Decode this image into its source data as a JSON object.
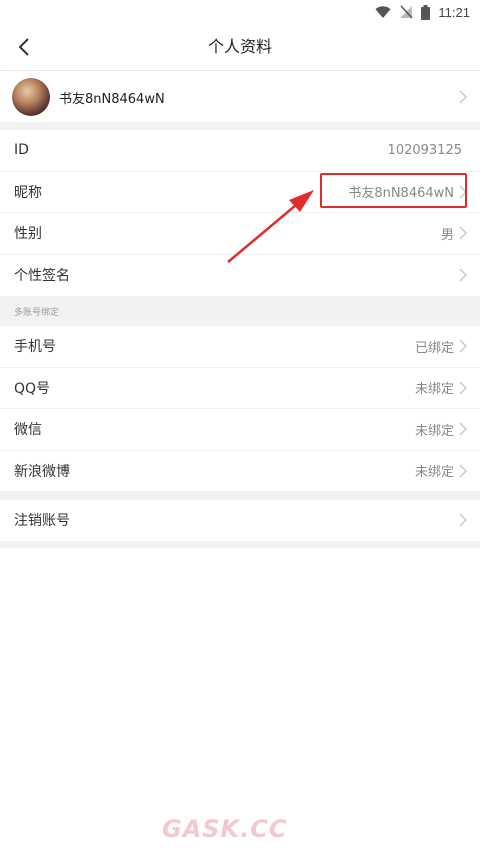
{
  "status_bar": {
    "time": "11:21"
  },
  "header": {
    "title": "个人资料"
  },
  "profile": {
    "nickname": "书友8nN8464wN"
  },
  "info": {
    "id": {
      "label": "ID",
      "value": "102093125"
    },
    "nickname": {
      "label": "昵称",
      "value": "书友8nN8464wN"
    },
    "gender": {
      "label": "性别",
      "value": "男"
    },
    "signature": {
      "label": "个性签名"
    }
  },
  "binding": {
    "caption": "多账号绑定",
    "phone": {
      "label": "手机号",
      "value": "已绑定"
    },
    "qq": {
      "label": "QQ号",
      "value": "未绑定"
    },
    "wechat": {
      "label": "微信",
      "value": "未绑定"
    },
    "weibo": {
      "label": "新浪微博",
      "value": "未绑定"
    }
  },
  "account": {
    "delete_label": "注销账号"
  },
  "watermark": "GASK.CC",
  "colors": {
    "highlight": "#e22b2b",
    "divider": "#f2f2f2",
    "value_text": "#888888"
  }
}
